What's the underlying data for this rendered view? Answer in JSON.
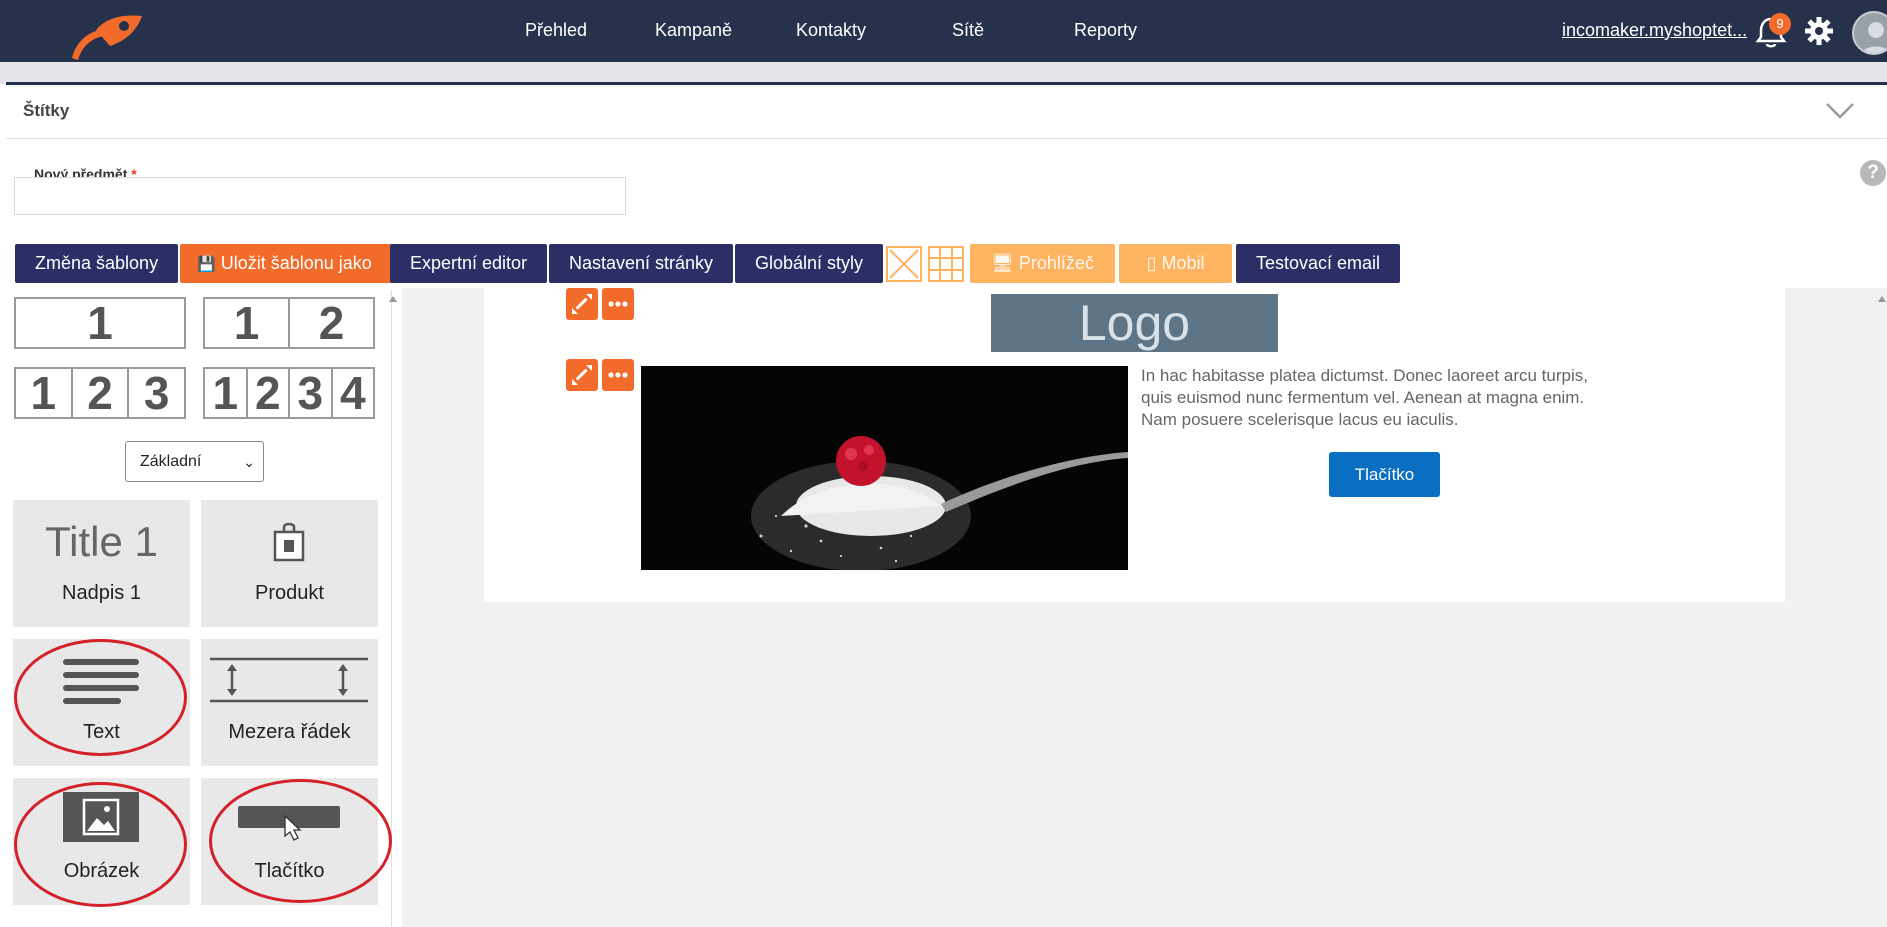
{
  "nav": {
    "items": [
      "Přehled",
      "Kampaně",
      "Kontakty",
      "Sítě",
      "Reporty"
    ],
    "user": "incomaker.myshoptet...",
    "notifications": "9"
  },
  "tags": {
    "title": "Štítky"
  },
  "subject": {
    "label": "Nový předmět",
    "required": "*",
    "value": ""
  },
  "toolbar": {
    "change_template": "Změna šablony",
    "save_template": "Uložit šablonu jako",
    "expert_editor": "Expertní editor",
    "page_settings": "Nastavení stránky",
    "global_styles": "Globální styly",
    "browser": "Prohlížeč",
    "mobile": "Mobil",
    "test_email": "Testovací email"
  },
  "sidebar": {
    "layouts": [
      [
        "1"
      ],
      [
        "1",
        "2"
      ],
      [
        "1",
        "2",
        "3"
      ],
      [
        "1",
        "2",
        "3",
        "4"
      ]
    ],
    "select_value": "Základní",
    "tiles": {
      "heading_preview": "Title 1",
      "heading": "Nadpis 1",
      "product": "Produkt",
      "text": "Text",
      "spacer": "Mezera řádek",
      "image": "Obrázek",
      "button": "Tlačítko"
    }
  },
  "email": {
    "logo": "Logo",
    "body_text": "In hac habitasse platea dictumst. Donec laoreet arcu turpis, quis euismod nunc fermentum vel. Aenean at magna enim. Nam posuere scelerisque lacus eu iaculis.",
    "button": "Tlačítko"
  },
  "colors": {
    "navbar": "#26314b",
    "navy_button": "#2c2f66",
    "orange": "#f26b2b",
    "peach": "#fdb35f",
    "email_button": "#0a6fc2",
    "highlight": "#d32029"
  }
}
